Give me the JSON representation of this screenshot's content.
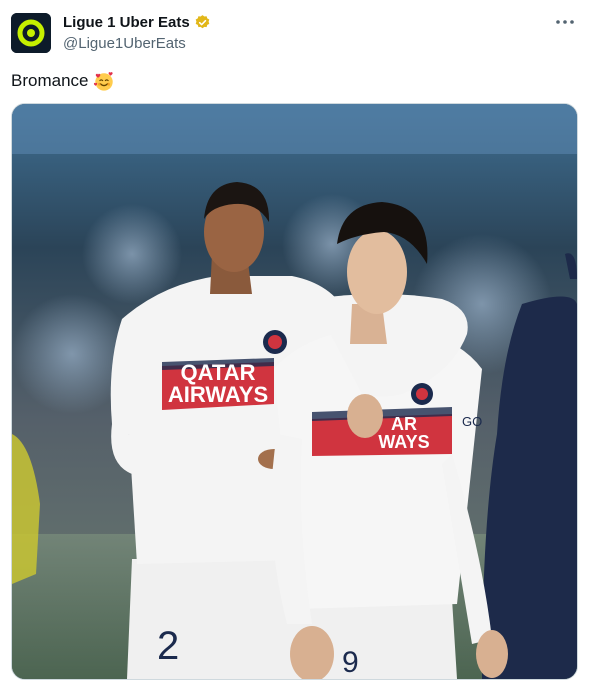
{
  "account": {
    "display_name": "Ligue 1 Uber Eats",
    "handle": "@Ligue1UberEats",
    "verified": true,
    "avatar_icon": "ligue1-logo-icon",
    "avatar_colors": {
      "background": "#0d1b2a",
      "ring": "#c6f000"
    }
  },
  "post": {
    "text": "Bromance",
    "emoji_icon": "smiling-face-with-hearts-icon"
  },
  "menu": {
    "icon": "more-options-icon"
  },
  "media": {
    "kit_text_left": "QATAR\nAIRWAYS",
    "kit_text_right": "AR\nWAYS",
    "number_left": "2",
    "number_right": "9",
    "sleeve_text": "GO",
    "colors": {
      "shirt": "#f2f2f2",
      "band": "#d0343f",
      "navy": "#1b2a4d"
    }
  }
}
